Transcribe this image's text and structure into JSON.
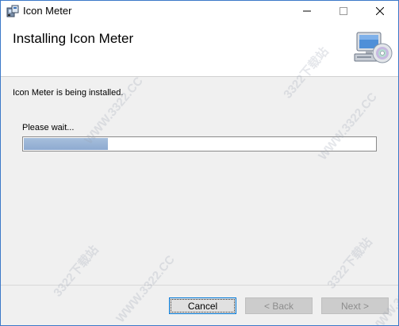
{
  "window": {
    "title": "Icon Meter",
    "app_icon": "installer-icon",
    "controls": {
      "minimize": "minimize-icon",
      "maximize": "maximize-icon",
      "close": "close-icon"
    }
  },
  "header": {
    "title": "Installing Icon Meter",
    "graphic": "computer-disc-icon"
  },
  "main": {
    "status": "Icon Meter is being installed.",
    "wait_label": "Please wait...",
    "progress_fraction": 0.24
  },
  "buttons": {
    "cancel": "Cancel",
    "back": "< Back",
    "next": "Next >"
  },
  "watermarks": [
    "WWW.3322.CC",
    "3322下载站"
  ],
  "colors": {
    "progress_fill": "#8eaad0",
    "default_button_border": "#0078d7",
    "window_border": "#3c78c8"
  }
}
